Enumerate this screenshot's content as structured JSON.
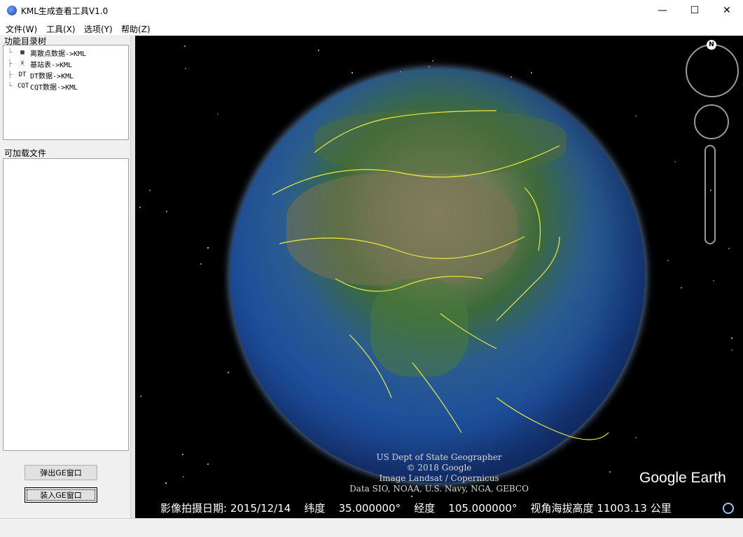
{
  "window": {
    "title": "KML生成查看工具V1.0",
    "minimize": "—",
    "maximize": "☐",
    "close": "✕"
  },
  "menu": [
    "文件(W)",
    "工具(X)",
    "选项(Y)",
    "帮助(Z)"
  ],
  "function_tree": {
    "label": "功能目录树",
    "items": [
      {
        "label": "离散点数据->KML",
        "icon": "grid-icon",
        "glyph": "▦"
      },
      {
        "label": "基站表->KML",
        "icon": "tower-icon",
        "glyph": "ᚸ"
      },
      {
        "label": "DT数据->KML",
        "icon": "dt-icon",
        "glyph": "DT"
      },
      {
        "label": "CQT数据->KML",
        "icon": "cqt-icon",
        "glyph": "CQT"
      }
    ]
  },
  "loadable_files": {
    "label": "可加载文件",
    "items": []
  },
  "buttons": {
    "popout": "弹出GE窗口",
    "dock": "装入GE窗口"
  },
  "map": {
    "credits": [
      "US Dept of State Geographer",
      "© 2018 Google",
      "Image Landsat / Copernicus",
      "Data SIO, NOAA, U.S. Navy, NGA, GEBCO"
    ],
    "logo": "Google Earth",
    "compass_label": "N",
    "status": {
      "date_label": "影像拍摄日期:",
      "date": "2015/12/14",
      "lat_label": "纬度",
      "lat": "35.000000°",
      "lon_label": "经度",
      "lon": "105.000000°",
      "alt_label": "视角海拔高度",
      "alt": "11003.13",
      "alt_unit": "公里"
    }
  }
}
